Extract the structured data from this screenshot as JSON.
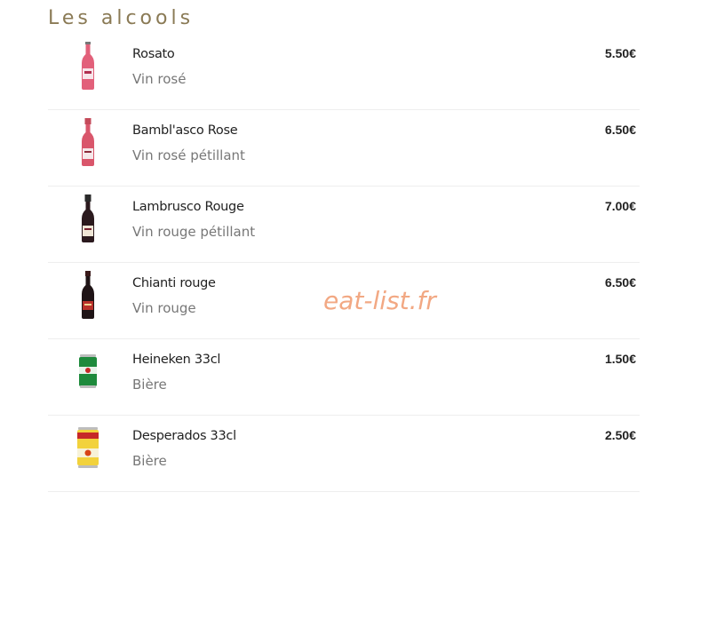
{
  "section": {
    "title": "Les alcools"
  },
  "items": [
    {
      "name": "Rosato",
      "description": "Vin rosé",
      "price": "5.50€",
      "icon": "rose-wine-bottle-icon"
    },
    {
      "name": "Bambl'asco Rose",
      "description": "Vin rosé pétillant",
      "price": "6.50€",
      "icon": "sparkling-rose-bottle-icon"
    },
    {
      "name": "Lambrusco Rouge",
      "description": "Vin rouge pétillant",
      "price": "7.00€",
      "icon": "red-sparkling-bottle-icon"
    },
    {
      "name": "Chianti rouge",
      "description": "Vin rouge",
      "price": "6.50€",
      "icon": "red-wine-bottle-icon"
    },
    {
      "name": "Heineken 33cl",
      "description": "Bière",
      "price": "1.50€",
      "icon": "heineken-can-icon"
    },
    {
      "name": "Desperados 33cl",
      "description": "Bière",
      "price": "2.50€",
      "icon": "desperados-can-icon"
    }
  ],
  "watermark": "eat-list.fr",
  "colors": {
    "title": "#8a7a55",
    "watermark": "#f2a883",
    "divider": "#eeeeee"
  }
}
